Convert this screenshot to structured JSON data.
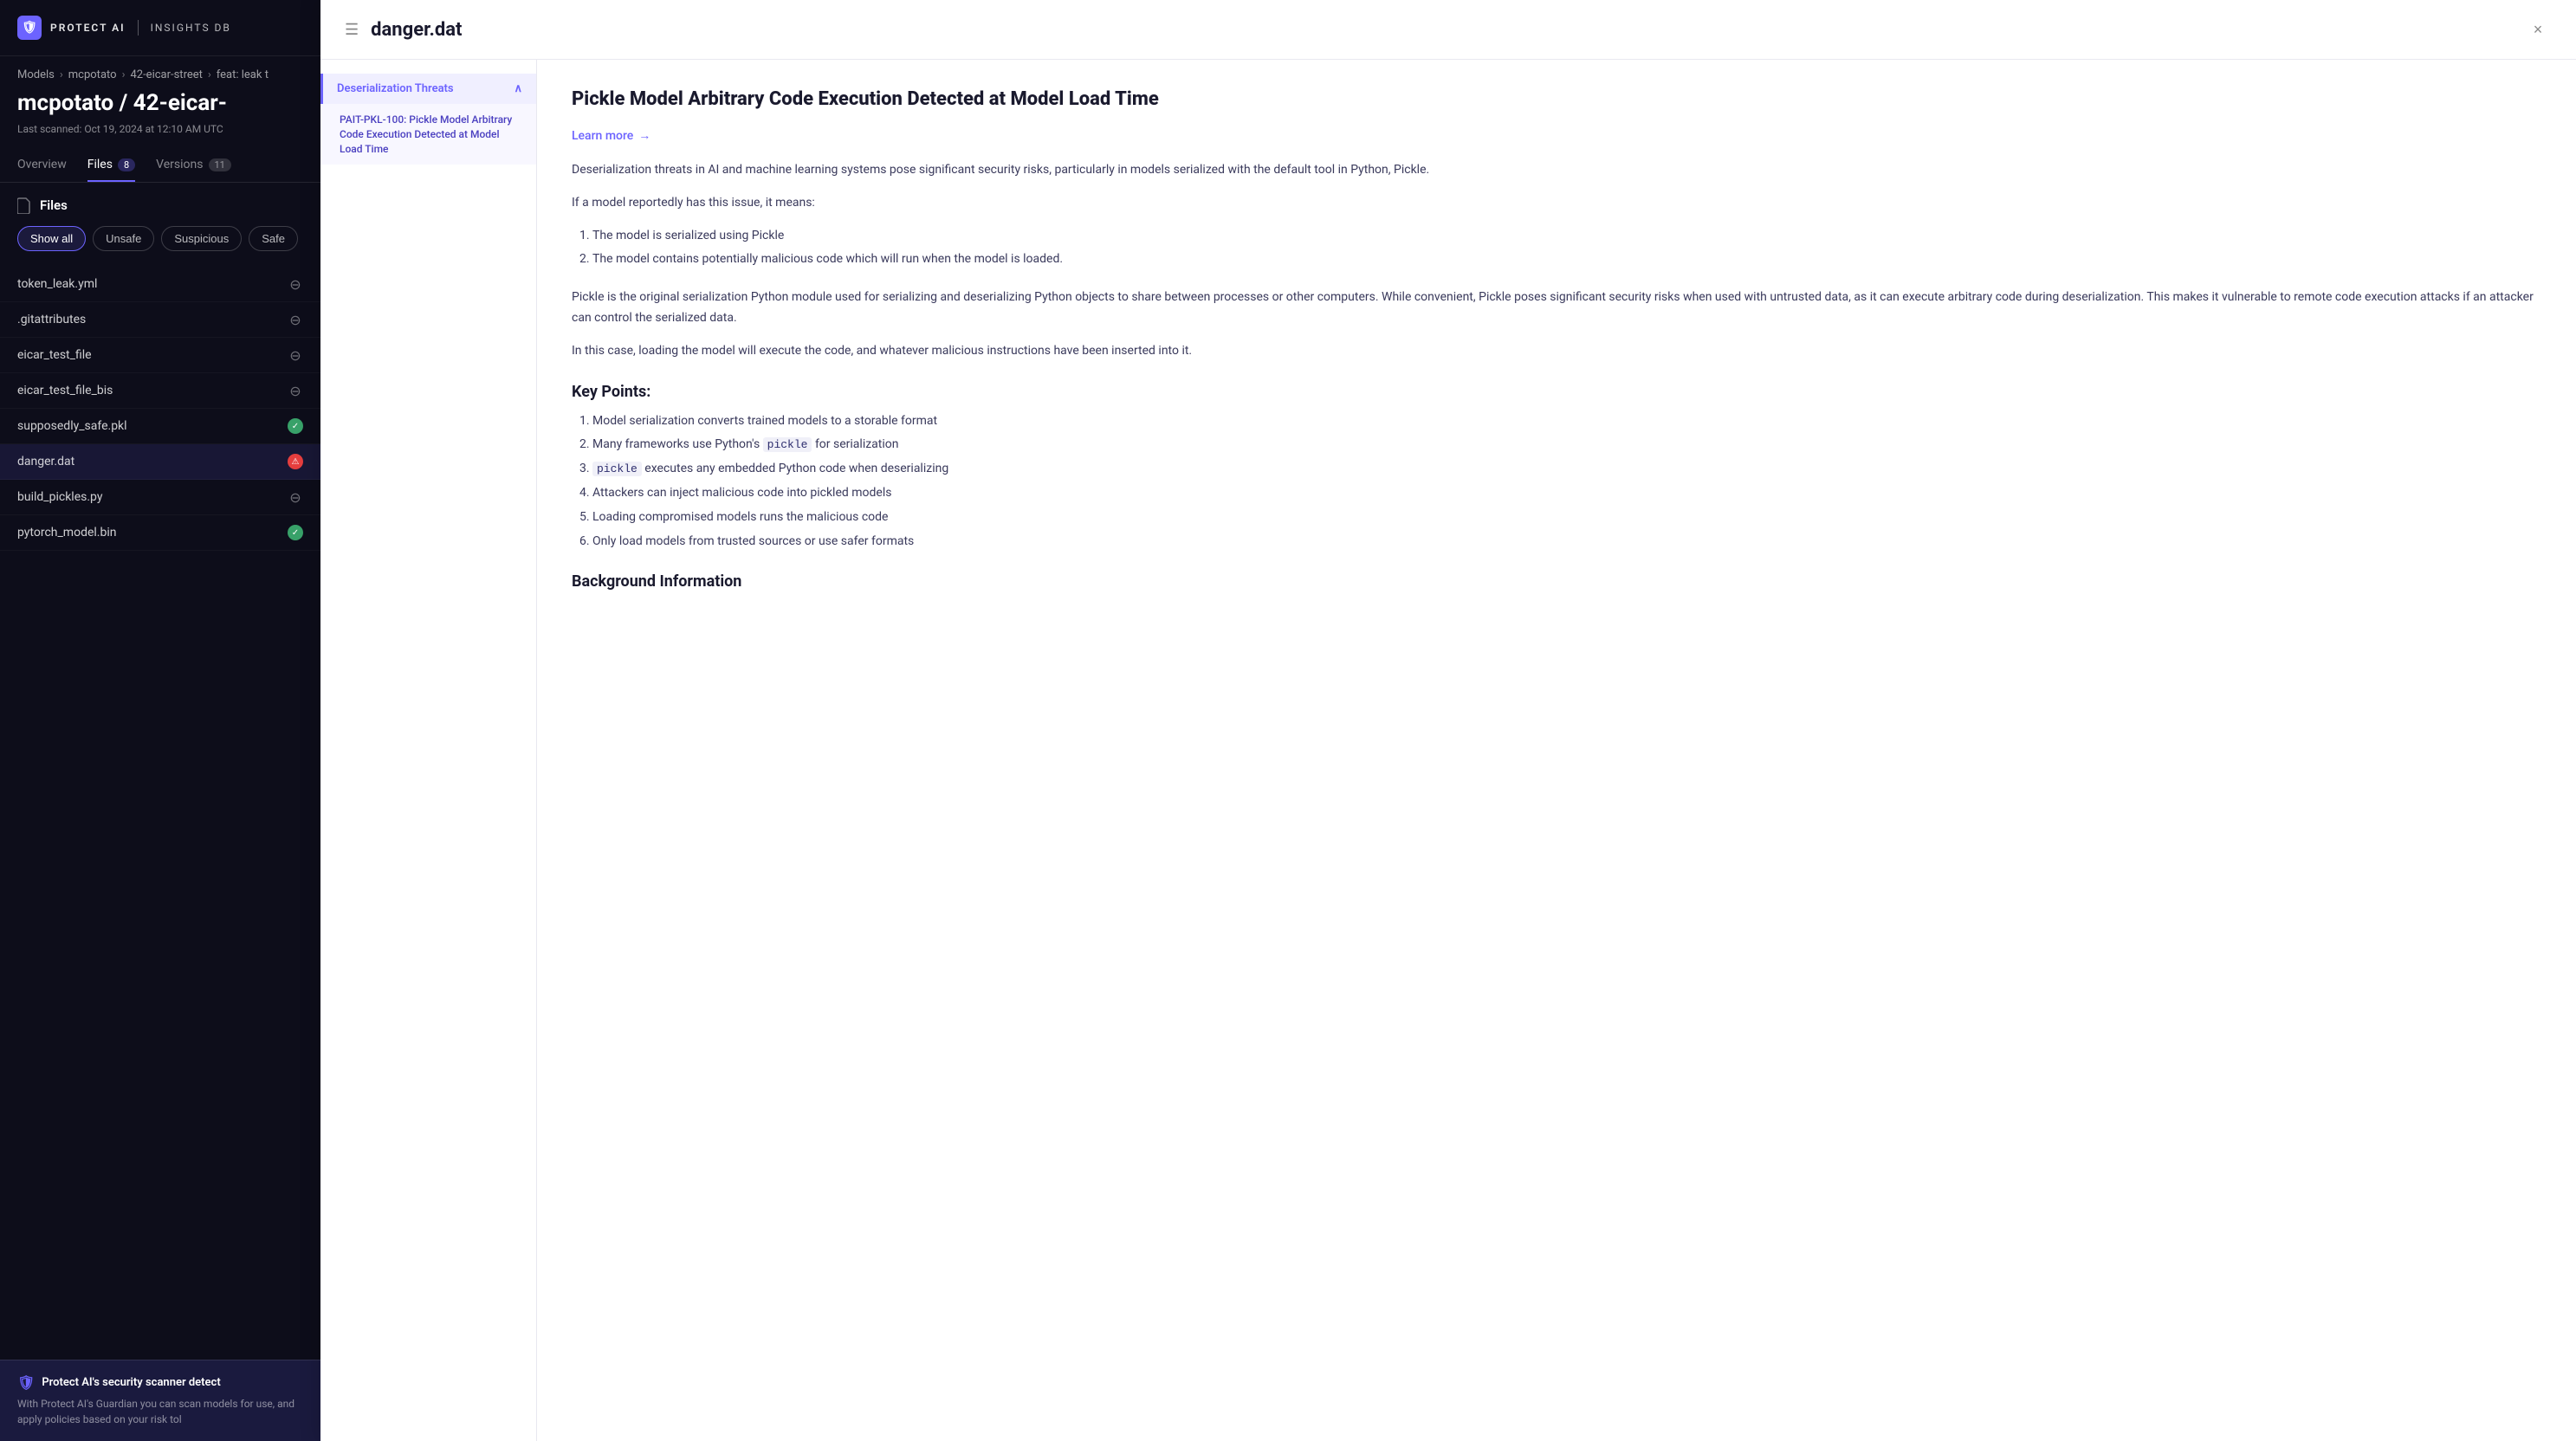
{
  "app": {
    "logo_name": "PROTECT AI",
    "logo_sub": "INSIGHTS DB"
  },
  "breadcrumb": {
    "items": [
      "Models",
      "mcpotato",
      "42-eicar-street",
      "feat: leak t"
    ]
  },
  "page": {
    "title": "mcpotato / 42-eicar-",
    "last_scanned": "Last scanned: Oct 19, 2024 at 12:10 AM UTC"
  },
  "tabs": [
    {
      "label": "Overview",
      "count": null,
      "active": false
    },
    {
      "label": "Files",
      "count": "8",
      "active": true
    },
    {
      "label": "Versions",
      "count": "11",
      "active": false
    }
  ],
  "files_section": {
    "header": "Files",
    "filters": [
      {
        "label": "Show all",
        "active": true
      },
      {
        "label": "Unsafe",
        "active": false
      },
      {
        "label": "Suspicious",
        "active": false
      },
      {
        "label": "Safe",
        "active": false
      }
    ],
    "files": [
      {
        "name": "token_leak.yml",
        "badge": "neutral"
      },
      {
        "name": ".gitattributes",
        "badge": "neutral"
      },
      {
        "name": "eicar_test_file",
        "badge": "neutral"
      },
      {
        "name": "eicar_test_file_bis",
        "badge": "neutral"
      },
      {
        "name": "supposedly_safe.pkl",
        "badge": "safe"
      },
      {
        "name": "danger.dat",
        "badge": "danger",
        "selected": true
      },
      {
        "name": "build_pickles.py",
        "badge": "neutral"
      },
      {
        "name": "pytorch_model.bin",
        "badge": "safe"
      }
    ]
  },
  "banner": {
    "title": "Protect AI's security scanner detect",
    "text": "With Protect AI's Guardian you can scan models for use, and apply policies based on your risk tol"
  },
  "overlay": {
    "title": "danger.dat",
    "close_label": "×",
    "nav": {
      "sections": [
        {
          "label": "Deserialization Threats",
          "expanded": true,
          "items": [
            "PAIT-PKL-100: Pickle Model Arbitrary Code Execution Detected at Model Load Time"
          ]
        }
      ]
    },
    "content": {
      "title": "Pickle Model Arbitrary Code Execution Detected at Model Load Time",
      "learn_more": "Learn more",
      "paragraphs": [
        "Deserialization threats in AI and machine learning systems pose significant security risks, particularly in models serialized with the default tool in Python, Pickle.",
        "If a model reportedly has this issue, it means:",
        "Pickle is the original serialization Python module used for serializing and deserializing Python objects to share between processes or other computers. While convenient, Pickle poses significant security risks when used with untrusted data, as it can execute arbitrary code during deserialization. This makes it vulnerable to remote code execution attacks if an attacker can control the serialized data.",
        "In this case, loading the model will execute the code, and whatever malicious instructions have been inserted into it."
      ],
      "list1": [
        "The model is serialized using Pickle",
        "The model contains potentially malicious code which will run when the model is loaded."
      ],
      "key_points_title": "Key Points:",
      "key_points": [
        "Model serialization converts trained models to a storable format",
        "Many frameworks use Python's pickle for serialization",
        "pickle executes any embedded Python code when deserializing",
        "Attackers can inject malicious code into pickled models",
        "Loading compromised models runs the malicious code",
        "Only load models from trusted sources or use safer formats"
      ],
      "key_points_code": [
        "pickle",
        "pickle"
      ],
      "background_title": "Background Information"
    }
  }
}
